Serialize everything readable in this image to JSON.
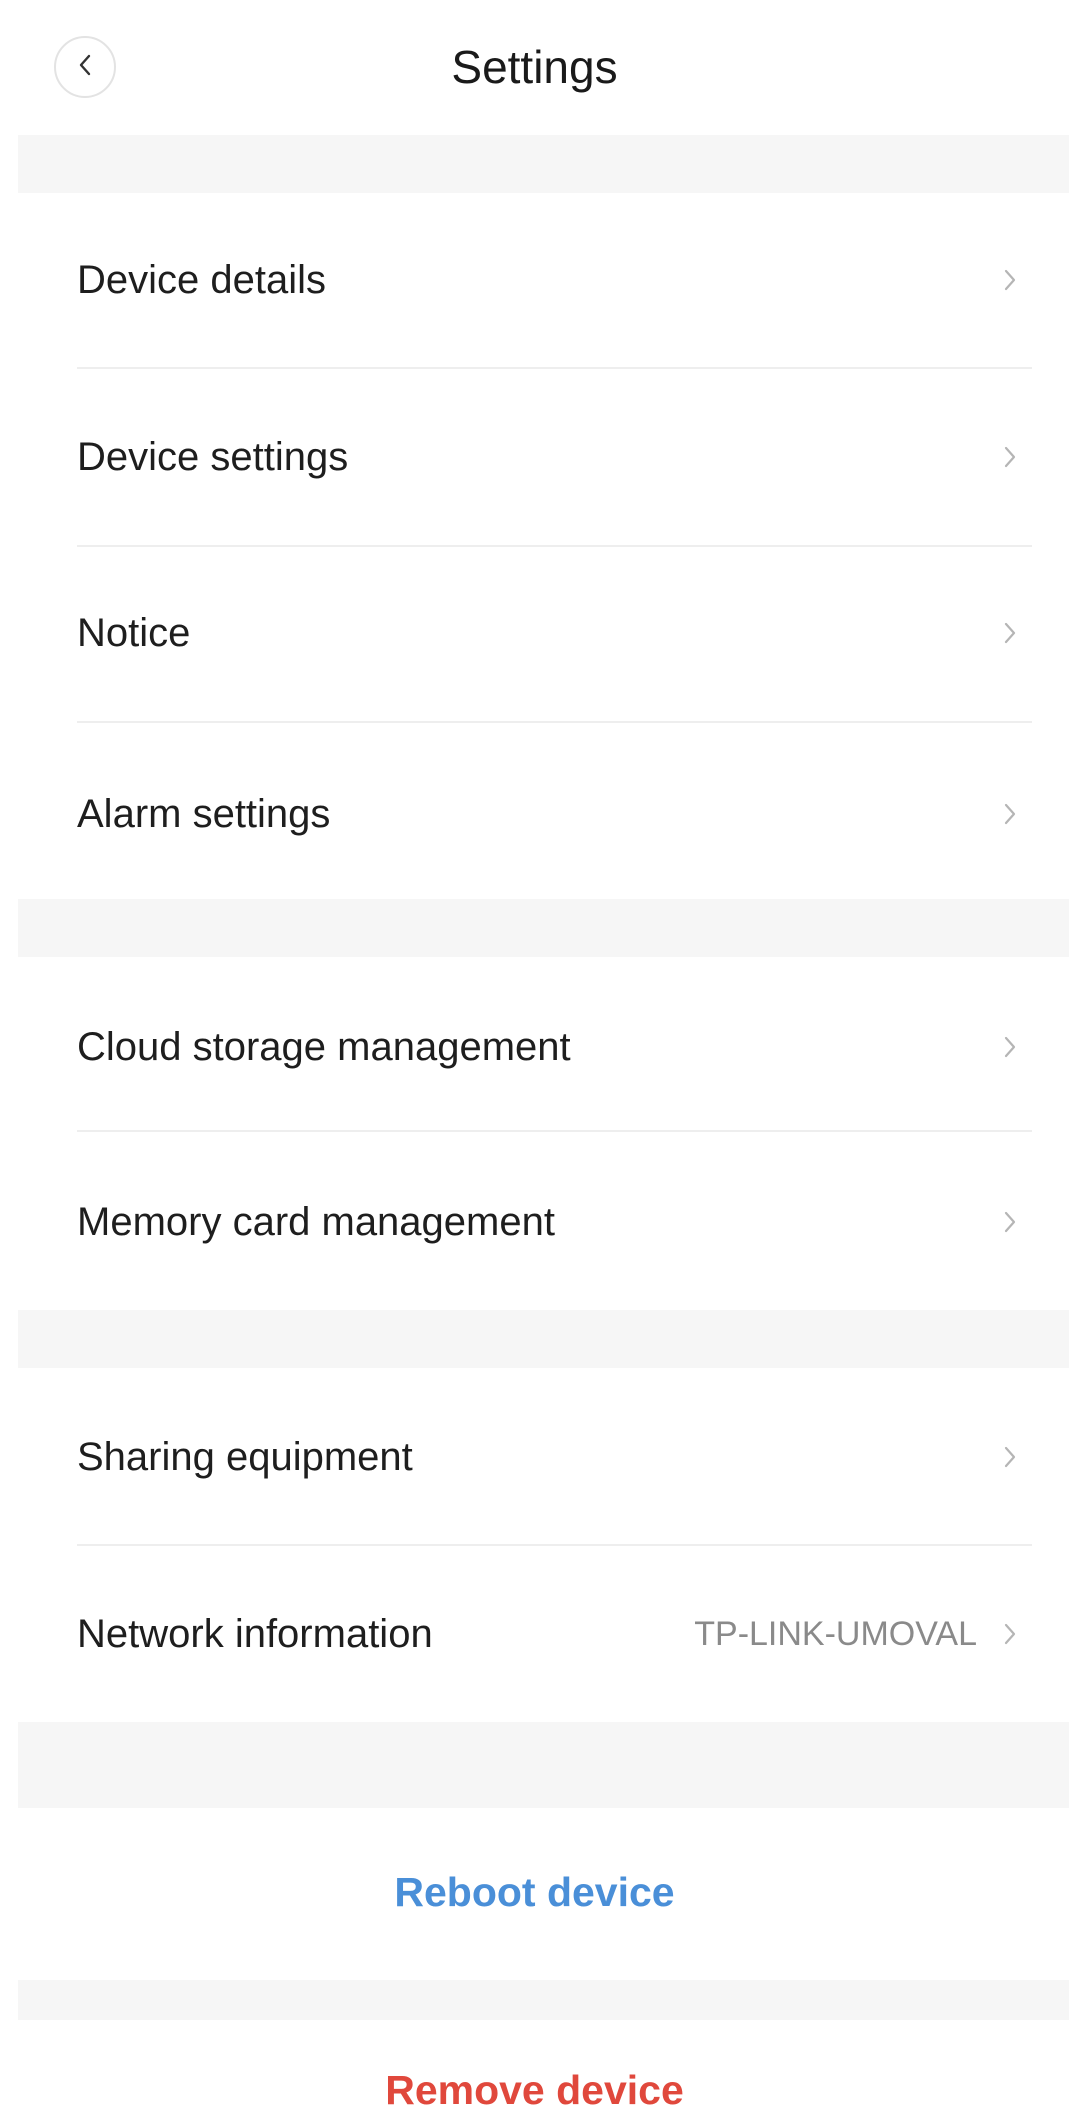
{
  "header": {
    "title": "Settings",
    "back_icon": "chevron-left-icon"
  },
  "groups": [
    {
      "items": [
        {
          "label": "Device details",
          "value": ""
        },
        {
          "label": "Device settings",
          "value": ""
        },
        {
          "label": "Notice",
          "value": ""
        },
        {
          "label": "Alarm settings",
          "value": ""
        }
      ]
    },
    {
      "items": [
        {
          "label": "Cloud storage management",
          "value": ""
        },
        {
          "label": "Memory card management",
          "value": ""
        }
      ]
    },
    {
      "items": [
        {
          "label": "Sharing equipment",
          "value": ""
        },
        {
          "label": "Network information",
          "value": "TP-LINK-UMOVAL"
        }
      ]
    }
  ],
  "actions": {
    "reboot_label": "Reboot device",
    "remove_label": "Remove device"
  },
  "colors": {
    "reboot": "#4a8fd8",
    "remove": "#e0483c",
    "gap_background": "#f6f6f6"
  }
}
